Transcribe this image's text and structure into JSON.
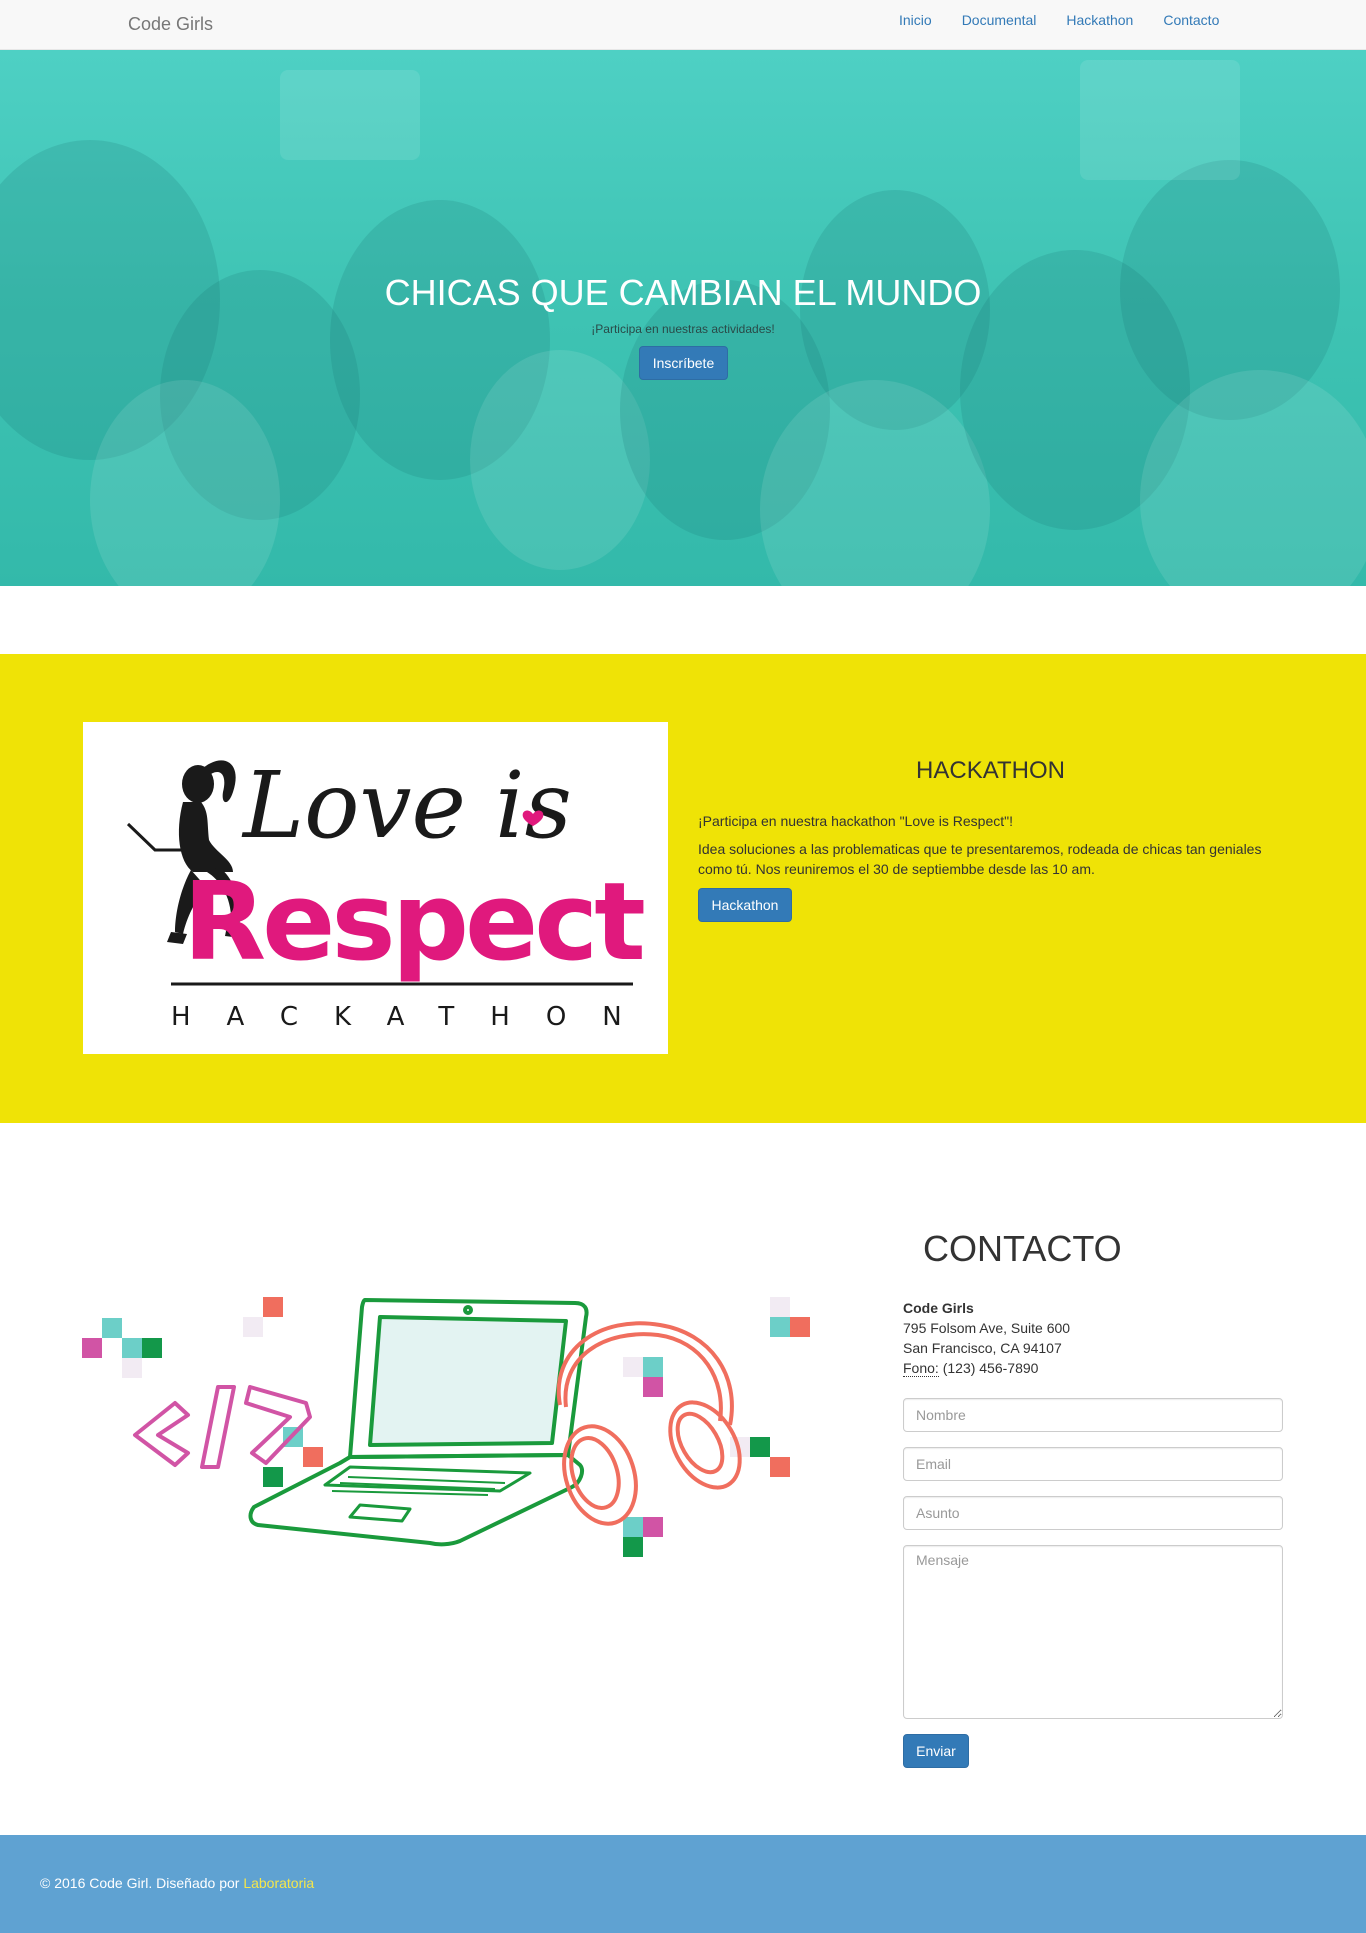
{
  "navbar": {
    "brand": "Code Girls",
    "links": [
      "Inicio",
      "Documental",
      "Hackathon",
      "Contacto"
    ]
  },
  "hero": {
    "title": "CHICAS QUE CAMBIAN EL MUNDO",
    "subtitle": "¡Participa en nuestras actividades!",
    "button": "Inscríbete"
  },
  "hackathon": {
    "logo": {
      "script_text": "Love is",
      "main_text": "Respect",
      "sub_text": "HACKATHON"
    },
    "title": "HACKATHON",
    "paragraph1": "¡Participa en nuestra hackathon \"Love is Respect\"!",
    "paragraph2": "Idea soluciones a las problematicas que te presentaremos, rodeada de chicas tan geniales como tú. Nos reuniremos el 30 de septiembbe desde las 10 am.",
    "button": "Hackathon"
  },
  "contact": {
    "title": "CONTACTO",
    "org": "Code Girls",
    "address_line1": "795 Folsom Ave, Suite 600",
    "address_line2": "San Francisco, CA 94107",
    "phone_label": "Fono:",
    "phone": "(123) 456-7890",
    "placeholders": {
      "name": "Nombre",
      "email": "Email",
      "subject": "Asunto",
      "message": "Mensaje"
    },
    "button": "Enviar"
  },
  "footer": {
    "text": "© 2016 Code Girl. Diseñado por",
    "link": "Laboratoria"
  },
  "colors": {
    "hero_teal": "#44c9bb",
    "hackathon_yellow": "#efe306",
    "primary_blue": "#337ab7",
    "footer_blue": "#5fa2d2",
    "footer_link": "#f5e64a",
    "logo_pink": "#e0197d",
    "laptop_green": "#1a9a3c",
    "headphones_coral": "#f06e5e"
  }
}
